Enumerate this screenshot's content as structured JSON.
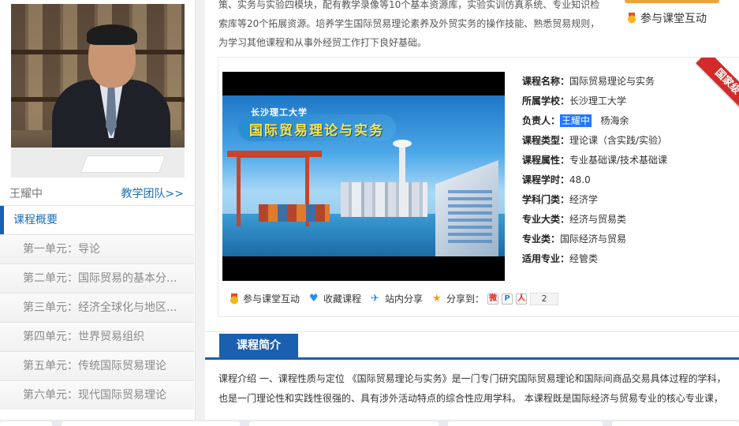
{
  "sidebar": {
    "teacher_name": "王耀中",
    "team_link": "教学团队>>",
    "items": [
      {
        "label": "课程概要"
      },
      {
        "label": "第一单元：导论"
      },
      {
        "label": "第二单元：国际贸易的基本分..."
      },
      {
        "label": "第三单元：经济全球化与地区..."
      },
      {
        "label": "第四单元：世界贸易组织"
      },
      {
        "label": "第五单元：传统国际贸易理论"
      },
      {
        "label": "第六单元：现代国际贸易理论"
      }
    ]
  },
  "top": {
    "intro_lines": [
      "策、实务与实验四模块，配有教学录像等10个基本资源库，实验实训仿真系统、专业知识检",
      "索库等20个拓展资源。培养学生国际贸易理论素养及外贸实务的操作技能、熟悉贸易规则，",
      "为学习其他课程和从事外经贸工作打下良好基础。"
    ],
    "interact_label": "参与课堂互动"
  },
  "video": {
    "university": "长沙理工大学",
    "title": "国际贸易理论与实务"
  },
  "badge": "国家级",
  "course_info": {
    "name_label": "课程名称：",
    "name_value": "国际贸易理论与实务",
    "school_label": "所属学校：",
    "school_value": "长沙理工大学",
    "leader_label": "负责人：",
    "leader_value_1": "王耀中",
    "leader_value_2": "杨海余",
    "type_label": "课程类型：",
    "type_value": "理论课（含实践/实验）",
    "attr_label": "课程属性：",
    "attr_value": "专业基础课/技术基础课",
    "hours_label": "课程学时：",
    "hours_value": "48.0",
    "discipline_label": "学科门类：",
    "discipline_value": "经济学",
    "major_cat_label": "专业大类：",
    "major_cat_value": "经济与贸易类",
    "major_class_label": "专业类：",
    "major_class_value": "国际经济与贸易",
    "suitable_label": "适用专业：",
    "suitable_value": "经管类"
  },
  "actions": {
    "interact": "参与课堂互动",
    "favorite": "收藏课程",
    "share_site": "站内分享",
    "share_to": "分享到：",
    "share_count": "2"
  },
  "section": {
    "tab_label": "课程简介",
    "desc_lines": [
      "课程介绍 一、课程性质与定位 《国际贸易理论与实务》是一门专门研究国际贸易理论和国际间商品交易具体过程的学科，",
      "也是一门理论性和实践性很强的、具有涉外活动特点的综合性应用学科。 本课程既是国际经济与贸易专业的核心专业课，"
    ]
  },
  "colors": {
    "brand_blue": "#1a5fb0",
    "link_blue": "#1c6fb5",
    "badge_red": "#d42a2a",
    "highlight": "#1e78ff"
  }
}
